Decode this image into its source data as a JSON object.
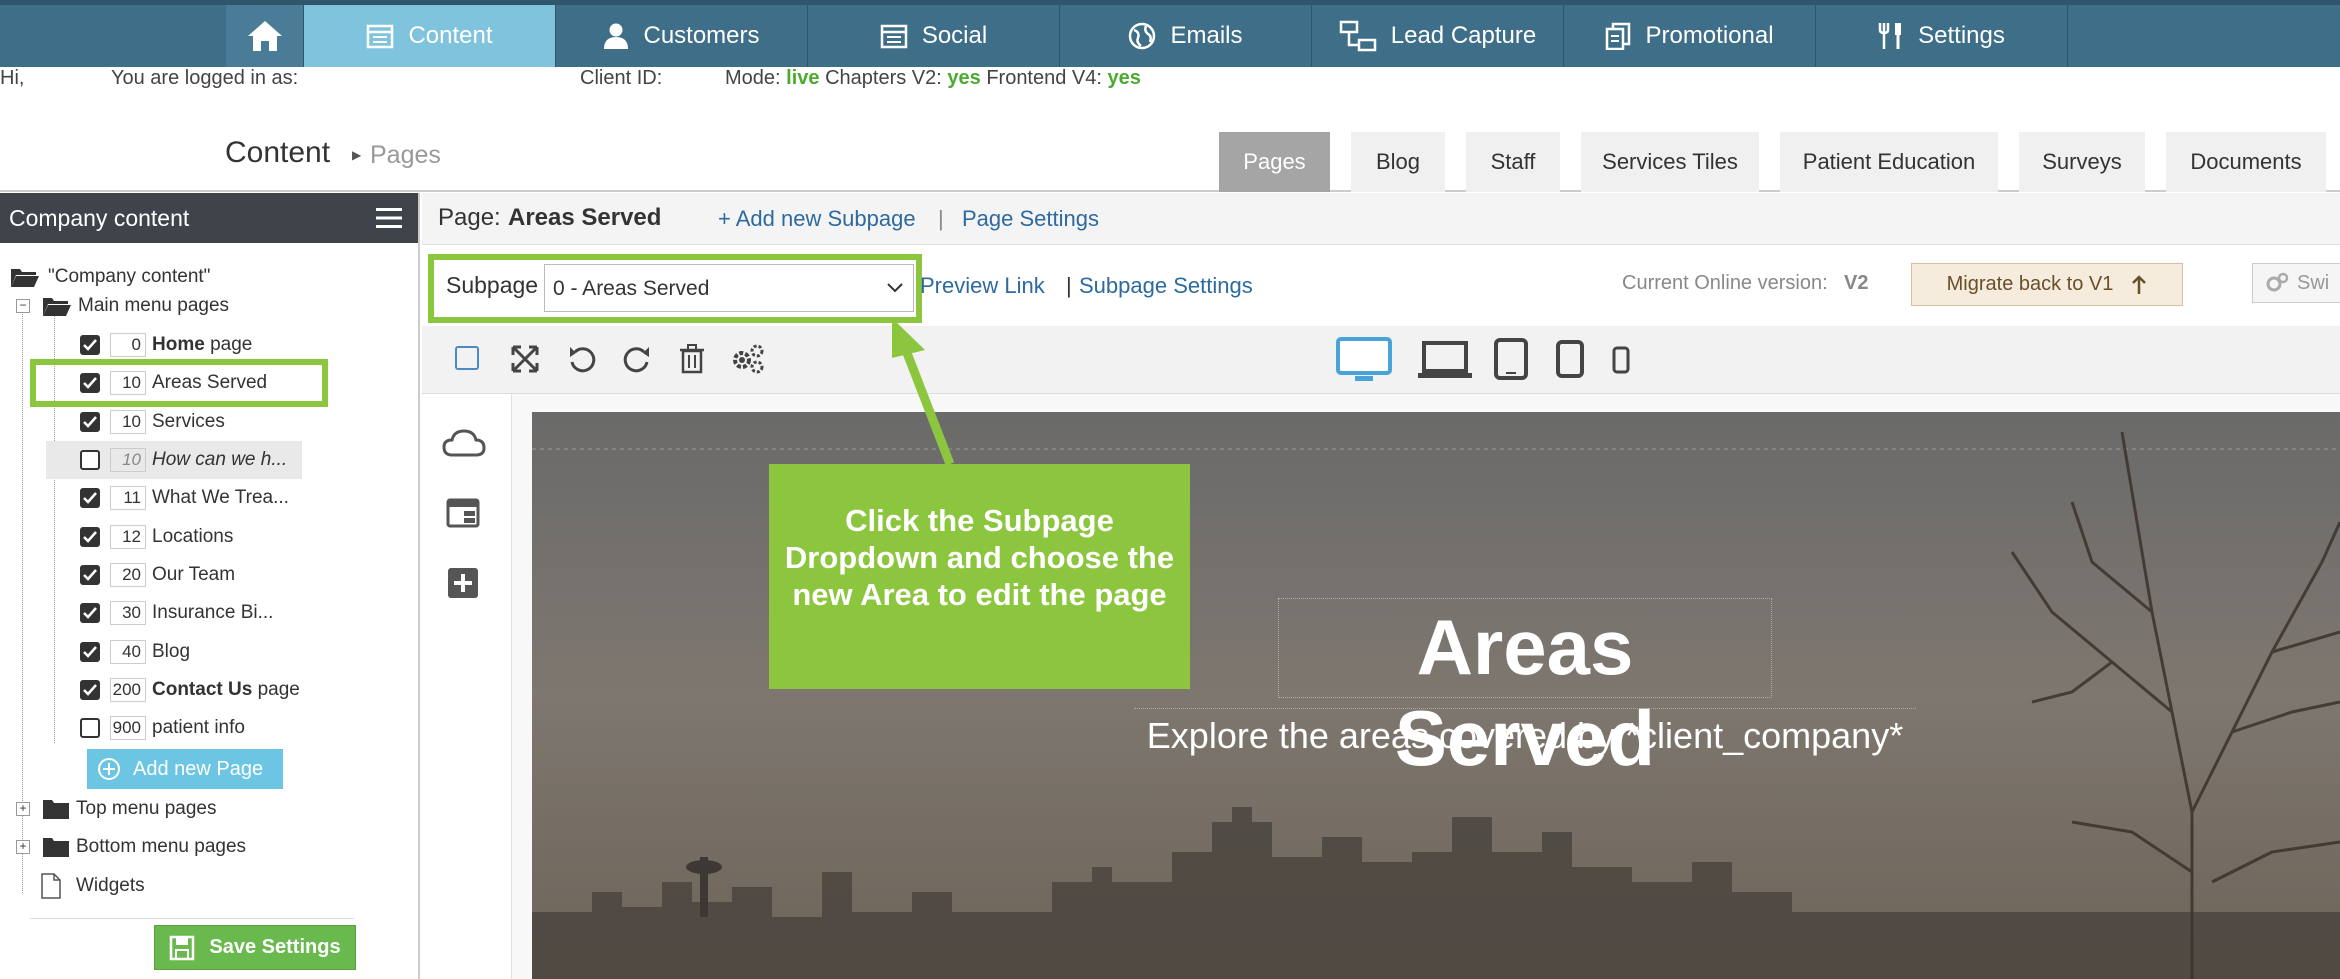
{
  "nav": {
    "items": [
      {
        "label": "Content",
        "icon": "calendar-icon",
        "active": true
      },
      {
        "label": "Customers",
        "icon": "user-icon"
      },
      {
        "label": "Social",
        "icon": "calendar-icon"
      },
      {
        "label": "Emails",
        "icon": "globe-icon"
      },
      {
        "label": "Lead Capture",
        "icon": "sitemap-icon"
      },
      {
        "label": "Promotional",
        "icon": "copy-icon"
      },
      {
        "label": "Settings",
        "icon": "tools-icon"
      }
    ]
  },
  "info": {
    "hi": "Hi,",
    "logged_in": "You are logged in as:",
    "client_id": "Client ID:",
    "mode_label": "Mode:",
    "mode_value": "live",
    "chapters_label": "Chapters V2:",
    "chapters_value": "yes",
    "frontend_label": "Frontend V4:",
    "frontend_value": "yes"
  },
  "header": {
    "title": "Content",
    "breadcrumb": "Pages",
    "tabs": [
      "Pages",
      "Blog",
      "Staff",
      "Services Tiles",
      "Patient Education",
      "Surveys",
      "Documents"
    ]
  },
  "sidebar": {
    "title": "Company content",
    "root": "\"Company content\"",
    "main_menu": "Main menu pages",
    "pages": [
      {
        "order": "0",
        "bold": "Home",
        "label": " page",
        "checked": true
      },
      {
        "order": "10",
        "label": "Areas Served",
        "checked": true,
        "selected": true
      },
      {
        "order": "10",
        "label": "Services",
        "checked": true
      },
      {
        "order": "10",
        "label": "How can we h...",
        "checked": false,
        "italic": true
      },
      {
        "order": "11",
        "label": "What We Trea...",
        "checked": true
      },
      {
        "order": "12",
        "label": "Locations",
        "checked": true
      },
      {
        "order": "20",
        "label": "Our Team",
        "checked": true
      },
      {
        "order": "30",
        "label": "Insurance Bi...",
        "checked": true
      },
      {
        "order": "40",
        "label": "Blog",
        "checked": true
      },
      {
        "order": "200",
        "bold": "Contact Us",
        "label": " page",
        "checked": true
      },
      {
        "order": "900",
        "label": "patient info",
        "checked": false
      }
    ],
    "add_page": "Add new Page",
    "top_menu": "Top menu pages",
    "bottom_menu": "Bottom menu pages",
    "widgets": "Widgets",
    "save": "Save Settings"
  },
  "page": {
    "label": "Page:",
    "name": "Areas Served",
    "add_subpage": "+ Add new Subpage",
    "sep": "|",
    "settings": "Page Settings"
  },
  "subpage": {
    "label": "Subpage",
    "selected": "0 - Areas Served",
    "preview": "Preview Link",
    "sep": "|",
    "settings": "Subpage Settings",
    "version_label": "Current Online version:",
    "version_value": "V2",
    "migrate": "Migrate back to V1",
    "switch": "Swi"
  },
  "hero": {
    "title": "Areas Served",
    "subtitle": "Explore the areas covered by *client_company*"
  },
  "callout": {
    "text": "Click the Subpage Dropdown and choose the new Area to edit the page"
  },
  "colors": {
    "nav_bg": "#3e6e88",
    "nav_active": "#7fc4dc",
    "highlight_green": "#8cc63f",
    "link_blue": "#2d6a9f"
  }
}
